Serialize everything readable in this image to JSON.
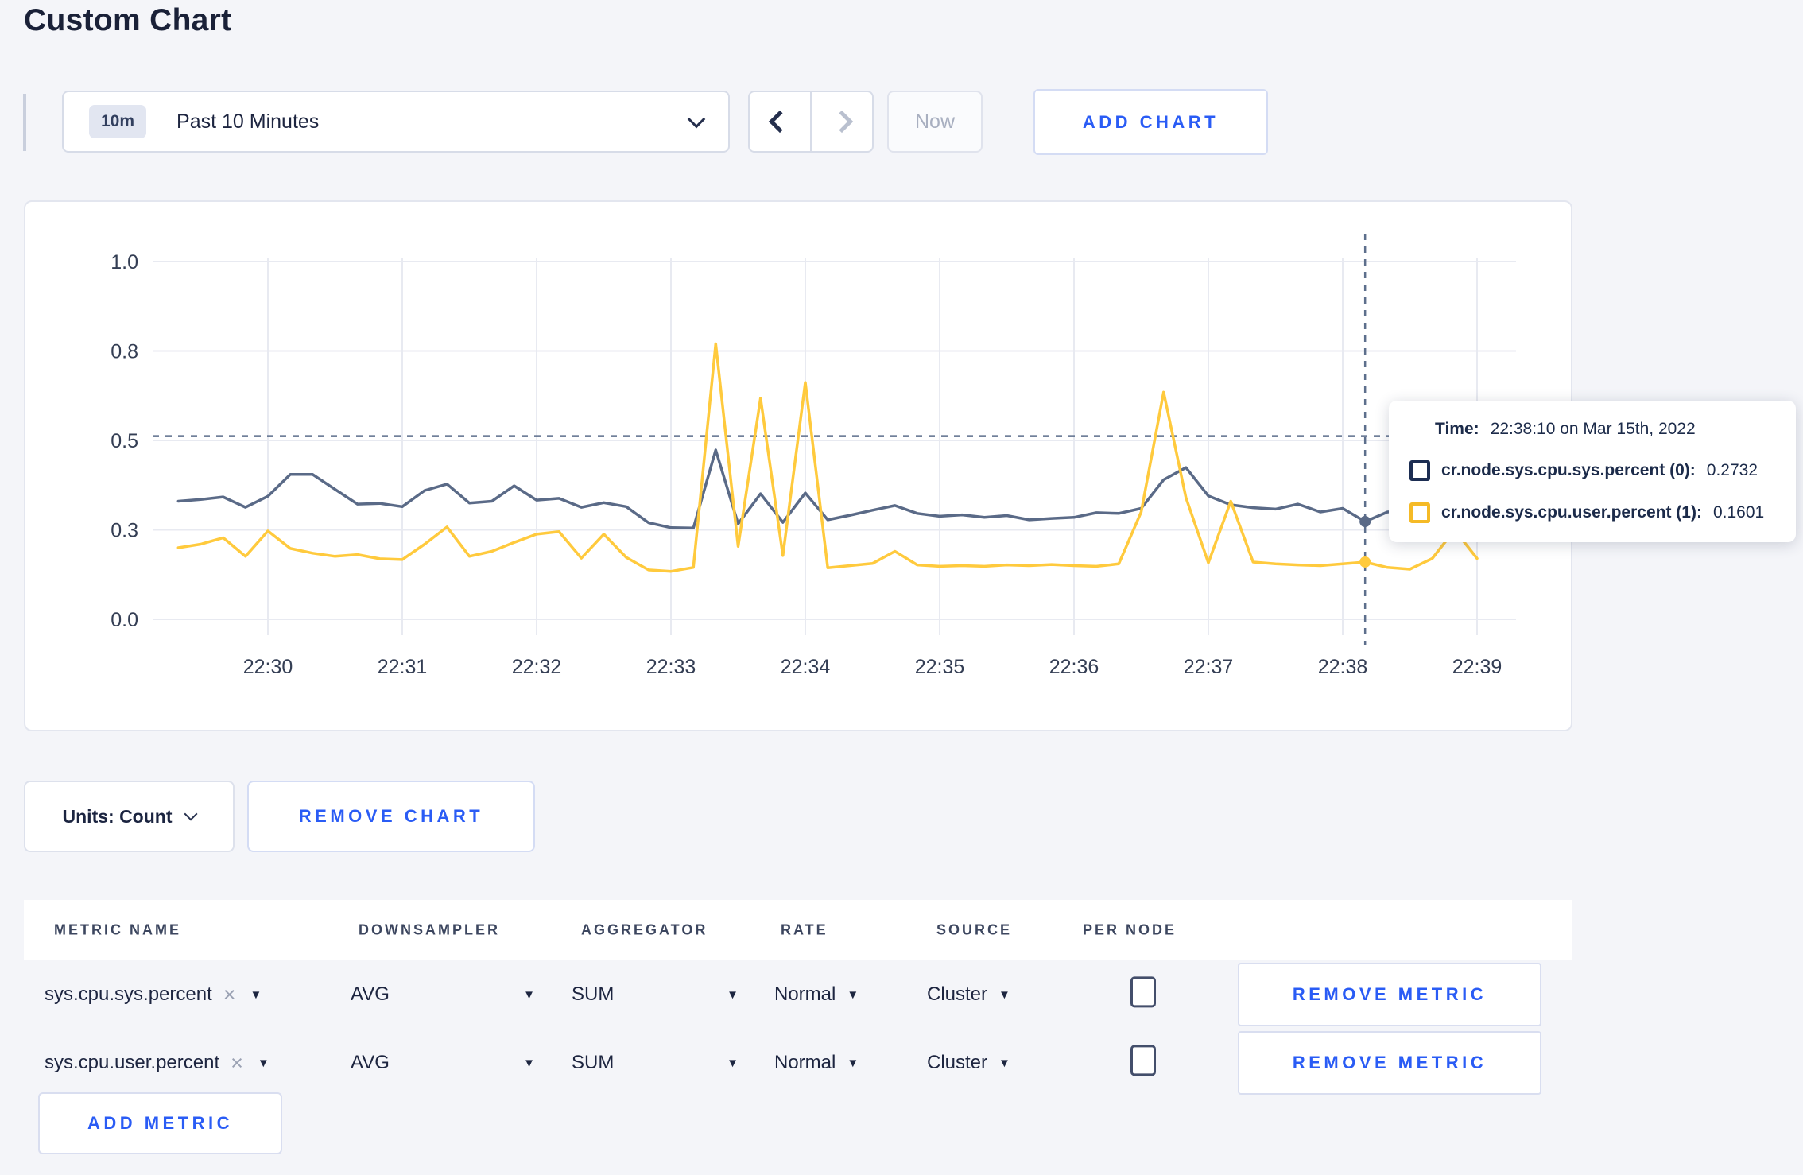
{
  "page": {
    "title": "Custom Chart",
    "background": "#f4f5f9",
    "accent_blue": "#2a5cf5"
  },
  "icons": {
    "dropdown_caret": "▼",
    "clear_x": "×"
  },
  "toolbar": {
    "time_badge": "10m",
    "time_label": "Past 10 Minutes",
    "now_label": "Now",
    "add_chart_label": "ADD CHART"
  },
  "chart_footer": {
    "units_label": "Units: Count",
    "remove_chart_label": "REMOVE CHART"
  },
  "tooltip": {
    "time_label": "Time:",
    "time_value": "22:38:10 on Mar 15th, 2022",
    "series": [
      {
        "name": "cr.node.sys.cpu.sys.percent (0):",
        "value": "0.2732",
        "swatch_color": "#1c2d52"
      },
      {
        "name": "cr.node.sys.cpu.user.percent (1):",
        "value": "0.1601",
        "swatch_color": "#f5ba26"
      }
    ]
  },
  "chart_data": {
    "type": "line",
    "title": "",
    "xlabel": "",
    "ylabel": "",
    "ylim": [
      0,
      1
    ],
    "grid": true,
    "legend_position": "tooltip",
    "y_ticks": [
      {
        "label": "1.0",
        "value": 1.0
      },
      {
        "label": "0.8",
        "value": 0.75
      },
      {
        "label": "0.5",
        "value": 0.5
      },
      {
        "label": "0.3",
        "value": 0.25
      },
      {
        "label": "0.0",
        "value": 0.0
      }
    ],
    "x_ticks": [
      {
        "label": "22:30",
        "time": "22:30:00"
      },
      {
        "label": "22:31",
        "time": "22:31:00"
      },
      {
        "label": "22:32",
        "time": "22:32:00"
      },
      {
        "label": "22:33",
        "time": "22:33:00"
      },
      {
        "label": "22:34",
        "time": "22:34:00"
      },
      {
        "label": "22:35",
        "time": "22:35:00"
      },
      {
        "label": "22:36",
        "time": "22:36:00"
      },
      {
        "label": "22:37",
        "time": "22:37:00"
      },
      {
        "label": "22:38",
        "time": "22:38:00"
      },
      {
        "label": "22:39",
        "time": "22:39:00"
      }
    ],
    "x": [
      "22:29:20",
      "22:29:30",
      "22:29:40",
      "22:29:50",
      "22:30:00",
      "22:30:10",
      "22:30:20",
      "22:30:30",
      "22:30:40",
      "22:30:50",
      "22:31:00",
      "22:31:10",
      "22:31:20",
      "22:31:30",
      "22:31:40",
      "22:31:50",
      "22:32:00",
      "22:32:10",
      "22:32:20",
      "22:32:30",
      "22:32:40",
      "22:32:50",
      "22:33:00",
      "22:33:10",
      "22:33:20",
      "22:33:30",
      "22:33:40",
      "22:33:50",
      "22:34:00",
      "22:34:10",
      "22:34:20",
      "22:34:30",
      "22:34:40",
      "22:34:50",
      "22:35:00",
      "22:35:10",
      "22:35:20",
      "22:35:30",
      "22:35:40",
      "22:35:50",
      "22:36:00",
      "22:36:10",
      "22:36:20",
      "22:36:30",
      "22:36:40",
      "22:36:50",
      "22:37:00",
      "22:37:10",
      "22:37:20",
      "22:37:30",
      "22:37:40",
      "22:37:50",
      "22:38:00",
      "22:38:10",
      "22:38:20",
      "22:38:30",
      "22:38:40",
      "22:38:50",
      "22:39:00"
    ],
    "series": [
      {
        "name": "cr.node.sys.cpu.sys.percent",
        "color": "#5a6a87",
        "legend_color": "#1c2d52",
        "values": [
          0.33,
          0.335,
          0.342,
          0.313,
          0.344,
          0.405,
          0.405,
          0.363,
          0.322,
          0.324,
          0.315,
          0.36,
          0.378,
          0.325,
          0.33,
          0.373,
          0.333,
          0.338,
          0.313,
          0.326,
          0.315,
          0.27,
          0.256,
          0.255,
          0.473,
          0.267,
          0.351,
          0.271,
          0.353,
          0.278,
          0.291,
          0.305,
          0.318,
          0.296,
          0.288,
          0.292,
          0.285,
          0.29,
          0.278,
          0.282,
          0.285,
          0.298,
          0.296,
          0.31,
          0.39,
          0.424,
          0.345,
          0.32,
          0.312,
          0.308,
          0.322,
          0.3,
          0.31,
          0.2732,
          0.3,
          0.303,
          0.298,
          0.31,
          0.3
        ]
      },
      {
        "name": "cr.node.sys.cpu.user.percent",
        "color": "#ffca3d",
        "legend_color": "#f5ba26",
        "values": [
          0.2,
          0.21,
          0.228,
          0.176,
          0.247,
          0.198,
          0.185,
          0.176,
          0.181,
          0.169,
          0.167,
          0.21,
          0.258,
          0.176,
          0.19,
          0.215,
          0.238,
          0.245,
          0.171,
          0.238,
          0.173,
          0.138,
          0.134,
          0.145,
          0.77,
          0.204,
          0.618,
          0.178,
          0.662,
          0.144,
          0.15,
          0.156,
          0.19,
          0.152,
          0.148,
          0.15,
          0.148,
          0.152,
          0.15,
          0.153,
          0.15,
          0.148,
          0.155,
          0.3,
          0.635,
          0.34,
          0.158,
          0.33,
          0.16,
          0.155,
          0.152,
          0.15,
          0.155,
          0.1601,
          0.145,
          0.14,
          0.17,
          0.25,
          0.17
        ]
      }
    ],
    "crosshair": {
      "time": "22:38:10",
      "hline_value": 0.512,
      "points": [
        {
          "series": 0,
          "value": 0.2732
        },
        {
          "series": 1,
          "value": 0.1601
        }
      ]
    }
  },
  "metrics_table": {
    "headers": [
      "METRIC NAME",
      "DOWNSAMPLER",
      "AGGREGATOR",
      "RATE",
      "SOURCE",
      "PER NODE"
    ],
    "rows": [
      {
        "metric": "sys.cpu.sys.percent",
        "downsampler": "AVG",
        "aggregator": "SUM",
        "rate": "Normal",
        "source": "Cluster",
        "per_node_checked": false,
        "remove_label": "REMOVE METRIC"
      },
      {
        "metric": "sys.cpu.user.percent",
        "downsampler": "AVG",
        "aggregator": "SUM",
        "rate": "Normal",
        "source": "Cluster",
        "per_node_checked": false,
        "remove_label": "REMOVE METRIC"
      }
    ],
    "add_metric_label": "ADD METRIC"
  }
}
